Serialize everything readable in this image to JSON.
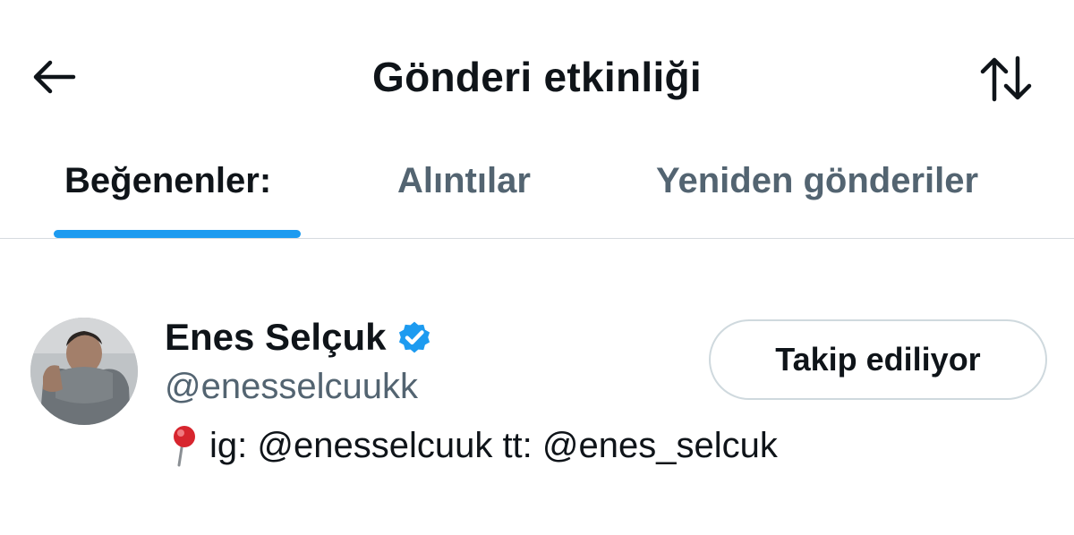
{
  "header": {
    "title": "Gönderi etkinliği",
    "back_icon": "arrow-left-icon",
    "sort_icon": "sort-arrows-icon"
  },
  "tabs": [
    {
      "label": "Beğenenler:",
      "active": true
    },
    {
      "label": "Alıntılar",
      "active": false
    },
    {
      "label": "Yeniden gönderiler",
      "active": false
    }
  ],
  "user": {
    "display_name": "Enes Selçuk",
    "verified": true,
    "handle": "@enesselcuukk",
    "bio": "ig: @enesselcuuk tt: @enes_selcuk",
    "bio_icon": "round-pushpin-icon",
    "follow_label": "Takip ediliyor"
  },
  "colors": {
    "accent": "#1d9bf0",
    "text_primary": "#0f1419",
    "text_secondary": "#536471",
    "border": "#cfd9de"
  }
}
